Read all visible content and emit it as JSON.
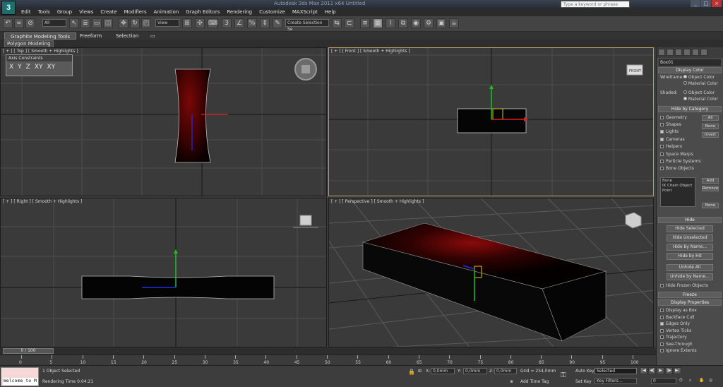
{
  "title_bar": {
    "app_title": "Autodesk 3ds Max 2011 x64    Untitled",
    "search_placeholder": "Type a keyword or phrase"
  },
  "menu": [
    "Edit",
    "Tools",
    "Group",
    "Views",
    "Create",
    "Modifiers",
    "Animation",
    "Graph Editors",
    "Rendering",
    "Customize",
    "MAXScript",
    "Help"
  ],
  "toolbar": {
    "selection_filter": "All",
    "reference_coord": "View",
    "named_selection": "Create Selection Se"
  },
  "ribbon": {
    "tabs": [
      "Graphite Modeling Tools",
      "Freeform",
      "Selection"
    ],
    "sub_tab": "Polygon Modeling"
  },
  "axis_constraints": {
    "title": "Axis Constraints",
    "buttons": [
      "X",
      "Y",
      "Z",
      "XY",
      "XY"
    ]
  },
  "viewports": {
    "top": "[ + ] [ Top ] [ Smooth + Highlights ]",
    "front": "[ + ] [ Front ] [ Smooth + Highlights ]",
    "right": "[ + ] [ Right ] [ Smooth + Highlights ]",
    "perspective": "[ + ] [ Perspective ] [ Smooth + Highlights ]"
  },
  "viewcube_labels": {
    "front": "FRONT"
  },
  "command_panel": {
    "object_name": "Box01",
    "display_color": {
      "header": "Display Color",
      "wireframe_label": "Wireframe:",
      "shaded_label": "Shaded:",
      "opt_object": "Object Color",
      "opt_material": "Material Color"
    },
    "hide_by_category": {
      "header": "Hide by Category",
      "items": [
        "Geometry",
        "Shapes",
        "Lights",
        "Cameras",
        "Helpers",
        "Space Warps",
        "Particle Systems",
        "Bone Objects"
      ],
      "btn_all": "All",
      "btn_none": "None",
      "btn_invert": "Invert",
      "list_items": [
        "Bone",
        "IK Chain Object",
        "Point"
      ],
      "btn_add": "Add",
      "btn_remove": "Remove",
      "btn_none2": "None"
    },
    "hide": {
      "header": "Hide",
      "buttons": [
        "Hide Selected",
        "Hide Unselected",
        "Hide by Name...",
        "Hide by Hit",
        "Unhide All",
        "Unhide by Name..."
      ],
      "frozen_label": "Hide Frozen Objects"
    },
    "freeze": {
      "header": "Freeze"
    },
    "display_properties": {
      "header": "Display Properties",
      "items": [
        "Display as Box",
        "Backface Cull",
        "Edges Only",
        "Vertex Ticks",
        "Trajectory",
        "See-Through",
        "Ignore Extents"
      ]
    }
  },
  "timeslider": {
    "position": "0 / 100",
    "ticks": [
      "0",
      "5",
      "10",
      "15",
      "20",
      "25",
      "30",
      "35",
      "40",
      "45",
      "50",
      "55",
      "60",
      "65",
      "70",
      "75",
      "80",
      "85",
      "90",
      "95",
      "100"
    ]
  },
  "statusbar": {
    "maxscript_text": "Welcome to M",
    "selection_status": "1 Object Selected",
    "render_time": "Rendering Time  0:04:21",
    "x_label": "X:",
    "x_value": "0,0mm",
    "y_label": "Y:",
    "y_value": "0,0mm",
    "z_label": "Z:",
    "z_value": "0,0mm",
    "grid": "Grid = 254,0mm",
    "add_time_tag": "Add Time Tag",
    "auto_key": "Auto Key",
    "set_key": "Set Key",
    "key_mode": "Selected",
    "key_filters": "Key Filters...",
    "frame": "0"
  }
}
